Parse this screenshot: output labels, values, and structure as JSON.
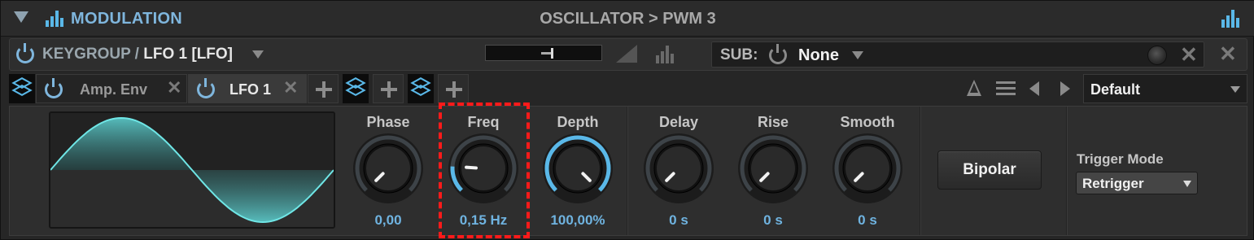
{
  "header": {
    "title": "MODULATION",
    "path": "OSCILLATOR > PWM 3"
  },
  "source": {
    "prefix": "KEYGROUP /",
    "name": "LFO 1 [LFO]",
    "sub_label": "SUB:",
    "sub_value": "None"
  },
  "tabs": [
    {
      "label": "Amp. Env",
      "active": false
    },
    {
      "label": "LFO 1",
      "active": true
    }
  ],
  "preset": {
    "value": "Default"
  },
  "params": [
    {
      "label": "Phase",
      "value": "0,00",
      "level": 0.0
    },
    {
      "label": "Freq",
      "value": "0,15 Hz",
      "level": 0.18
    },
    {
      "label": "Depth",
      "value": "100,00%",
      "level": 1.0
    },
    {
      "label": "Delay",
      "value": "0 s",
      "level": 0.0
    },
    {
      "label": "Rise",
      "value": "0 s",
      "level": 0.0
    },
    {
      "label": "Smooth",
      "value": "0 s",
      "level": 0.0
    }
  ],
  "bipolar_label": "Bipolar",
  "trigger_mode": {
    "label": "Trigger Mode",
    "value": "Retrigger"
  },
  "colors": {
    "accent": "#5ab8e8",
    "wave": "#5fd6d6",
    "highlight": "#ff1a1a"
  },
  "icons": [
    "collapse-triangle-icon",
    "bars-icon",
    "power-icon",
    "layers-icon",
    "plus-icon",
    "close-icon",
    "metronome-icon",
    "menu-icon",
    "arrow-left-icon",
    "arrow-right-icon",
    "dropdown-caret-icon"
  ]
}
